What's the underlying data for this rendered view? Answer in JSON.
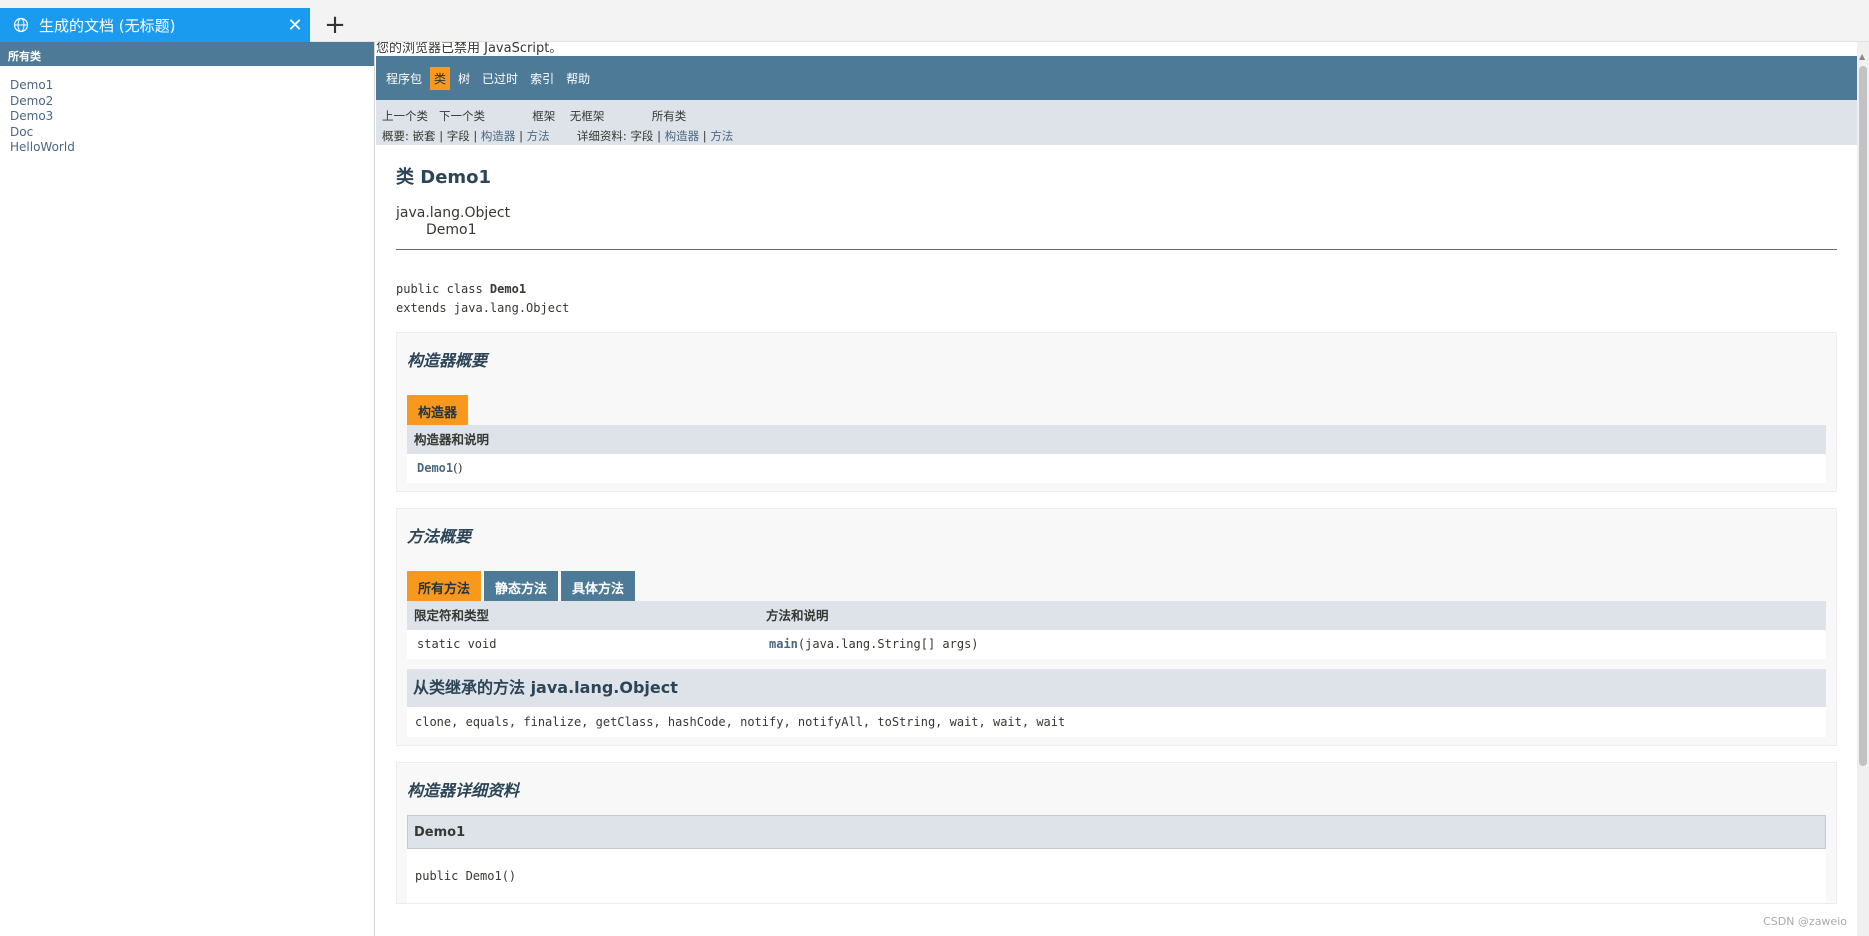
{
  "browser": {
    "tab_title": "生成的文档 (无标题)",
    "close_glyph": "✕",
    "newtab_glyph": "+"
  },
  "left": {
    "header": "所有类",
    "classes": [
      "Demo1",
      "Demo2",
      "Demo3",
      "Doc",
      "HelloWorld"
    ]
  },
  "right": {
    "noscript": "您的浏览器已禁用 JavaScript。",
    "nav": [
      "程序包",
      "类",
      "树",
      "已过时",
      "索引",
      "帮助"
    ],
    "subnav": {
      "prev": "上一个类",
      "next": "下一个类",
      "frames": "框架",
      "noframes": "无框架",
      "allclasses": "所有类",
      "summary_label": "概要:",
      "summary_nested": "嵌套",
      "summary_field": "字段",
      "summary_ctor": "构造器",
      "summary_method": "方法",
      "detail_label": "详细资料:",
      "detail_field": "字段",
      "detail_ctor": "构造器",
      "detail_method": "方法",
      "sep": "|"
    },
    "class_title": "类 Demo1",
    "inherit_parent": "java.lang.Object",
    "inherit_child": "Demo1",
    "decl_line1_prefix": "public class ",
    "decl_line1_name": "Demo1",
    "decl_line2": "extends java.lang.Object",
    "ctor_summary": {
      "heading": "构造器概要",
      "tab": "构造器",
      "col": "构造器和说明",
      "row_name": "Demo1",
      "row_args": "()"
    },
    "method_summary": {
      "heading": "方法概要",
      "tabs": [
        "所有方法",
        "静态方法",
        "具体方法"
      ],
      "col1": "限定符和类型",
      "col2": "方法和说明",
      "row_type": "static void",
      "row_name": "main",
      "row_args": "(java.lang.String[] args)",
      "inherited_heading": "从类继承的方法 java.lang.Object",
      "inherited_methods": "clone, equals, finalize, getClass, hashCode, notify, notifyAll, toString, wait, wait, wait"
    },
    "ctor_detail": {
      "heading": "构造器详细资料",
      "name": "Demo1",
      "signature": "public Demo1()"
    }
  },
  "watermark": "CSDN @zaweio"
}
